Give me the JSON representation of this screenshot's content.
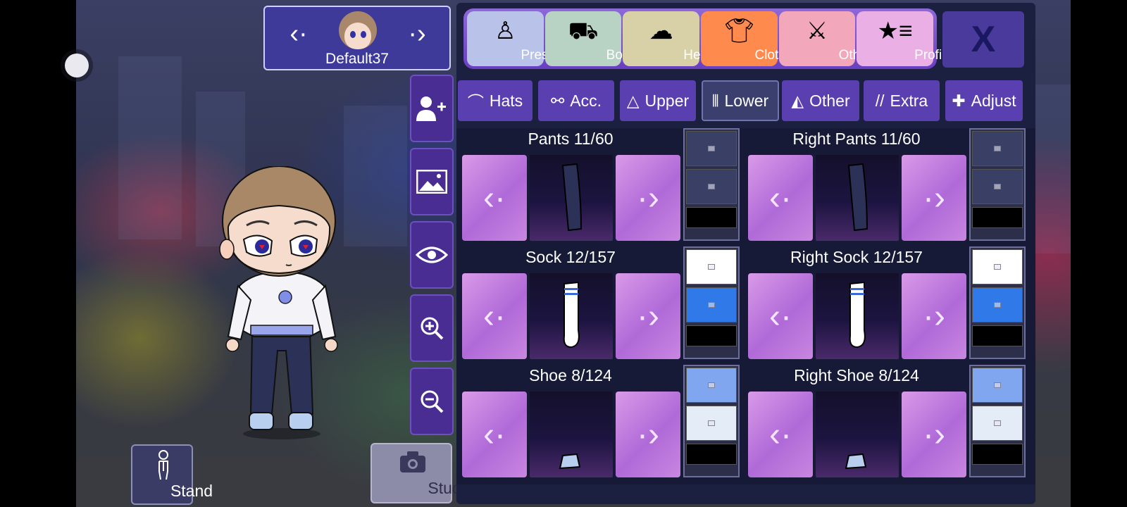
{
  "character": {
    "name": "Default37"
  },
  "categories": [
    {
      "label": "Presets",
      "icon": "presets-icon",
      "bg": "#b9c3ea"
    },
    {
      "label": "Body",
      "icon": "body-icon",
      "bg": "#b8d2c4"
    },
    {
      "label": "Head",
      "icon": "head-icon",
      "bg": "#d8d0a6"
    },
    {
      "label": "Clothes",
      "icon": "clothes-icon",
      "bg": "#ff8a4e"
    },
    {
      "label": "Other",
      "icon": "other-icon",
      "bg": "#f2a8ba"
    },
    {
      "label": "Profile",
      "icon": "profile-icon",
      "bg": "#eab0e6"
    }
  ],
  "close_label": "X",
  "subtabs": [
    {
      "label": "Hats",
      "icon": "cap-icon",
      "glyph": "⌒"
    },
    {
      "label": "Acc.",
      "icon": "glasses-icon",
      "glyph": "⚯"
    },
    {
      "label": "Upper",
      "icon": "hanger-icon",
      "glyph": "⩘"
    },
    {
      "label": "Lower",
      "icon": "pants-icon",
      "glyph": "⫴",
      "active": true
    },
    {
      "label": "Other",
      "icon": "fin-icon",
      "glyph": "◭"
    },
    {
      "label": "Extra",
      "icon": "slashes-icon",
      "glyph": "//"
    },
    {
      "label": "Adjust",
      "icon": "move-icon",
      "glyph": "✚"
    }
  ],
  "items": [
    {
      "title": "Pants 11/60",
      "kind": "pants",
      "swatches": [
        "#3a3f66",
        "#3a3f66",
        "#000000"
      ]
    },
    {
      "title": "Right Pants 11/60",
      "kind": "pants",
      "swatches": [
        "#3a3f66",
        "#3a3f66",
        "#000000"
      ]
    },
    {
      "title": "Sock 12/157",
      "kind": "sock",
      "swatches": [
        "#ffffff",
        "#2f7ae8",
        "#000000"
      ]
    },
    {
      "title": "Right Sock 12/157",
      "kind": "sock",
      "swatches": [
        "#ffffff",
        "#2f7ae8",
        "#000000"
      ]
    },
    {
      "title": "Shoe 8/124",
      "kind": "shoe",
      "swatches": [
        "#7fa6ee",
        "#e4ecf8",
        "#000000"
      ]
    },
    {
      "title": "Right Shoe 8/124",
      "kind": "shoe",
      "swatches": [
        "#7fa6ee",
        "#e4ecf8",
        "#000000"
      ]
    }
  ],
  "buttons": {
    "stand": "Stand",
    "studio": "Studio"
  }
}
